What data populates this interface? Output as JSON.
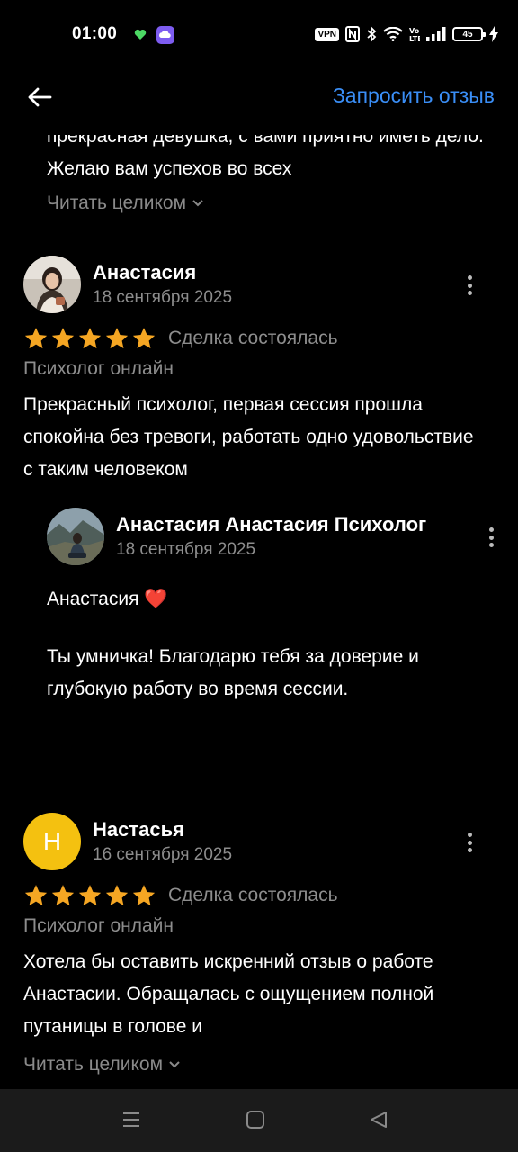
{
  "status": {
    "time": "01:00",
    "vpn": "VPN",
    "battery": "45",
    "icons": [
      "heart-icon",
      "cloud-app-icon",
      "nfc-icon",
      "bluetooth-icon",
      "wifi-icon",
      "volte-icon",
      "signal-icon",
      "battery-icon",
      "charging-icon"
    ]
  },
  "header": {
    "back_icon": "arrow-left-icon",
    "request_label": "Запросить отзыв"
  },
  "prev_review": {
    "text": "прекрасная девушка, с вами приятно иметь дело. Желаю вам успехов во всех",
    "read_more": "Читать целиком"
  },
  "reviews": [
    {
      "name": "Анастасия",
      "date": "18 сентября 2025",
      "rating": 5,
      "status": "Сделка состоялась",
      "service": "Психолог онлайн",
      "text": "Прекрасный психолог, первая сессия прошла спокойна без тревоги, работать одно удовольствие с таким человеком",
      "reply": {
        "name": "Анастасия Анастасия Психолог",
        "date": "18 сентября 2025",
        "line1": "Анастасия ❤️",
        "line2": "Ты умничка! Благодарю тебя за доверие и глубокую работу во время сессии."
      }
    },
    {
      "name": "Настасья",
      "avatar_letter": "Н",
      "date": "16 сентября 2025",
      "rating": 5,
      "status": "Сделка состоялась",
      "service": "Психолог онлайн",
      "text": "Хотела бы оставить искренний отзыв о работе Анастасии. Обращалась с ощущением полной путаницы в голове и",
      "read_more": "Читать целиком"
    }
  ],
  "colors": {
    "accent": "#3a8ef6",
    "star": "#f5a623",
    "avatar_yellow": "#f4c110",
    "muted_text": "#8d8d8d",
    "background": "#000000"
  },
  "nav": {
    "icons": [
      "menu-icon",
      "home-square-icon",
      "back-triangle-icon"
    ]
  }
}
